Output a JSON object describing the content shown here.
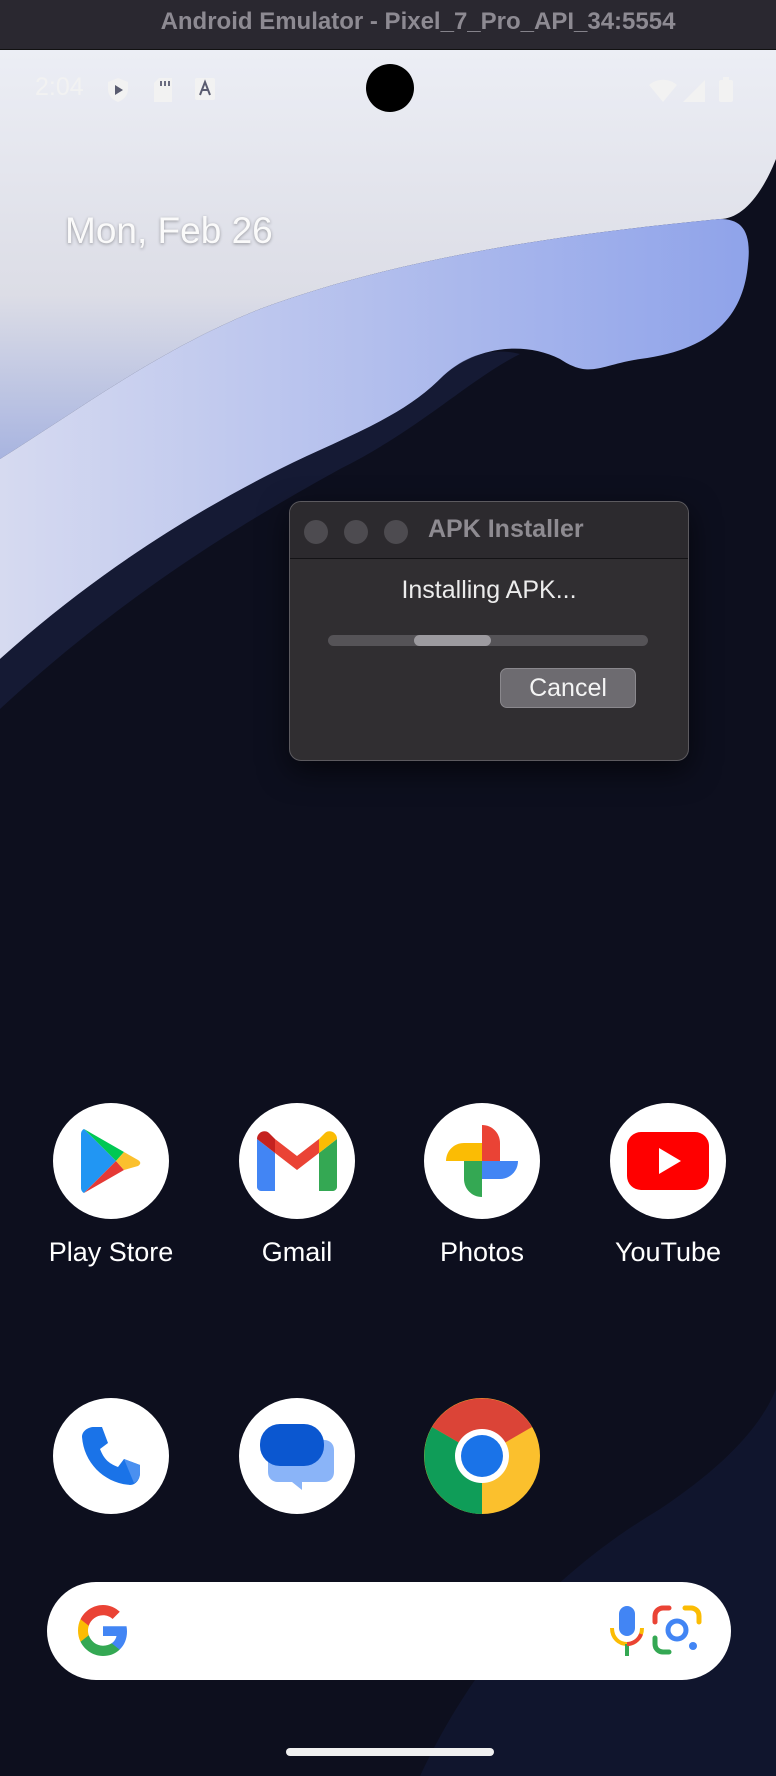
{
  "window": {
    "title": "Android Emulator - Pixel_7_Pro_API_34:5554"
  },
  "status_bar": {
    "time": "2:04",
    "left_icons": [
      "shield-play-icon",
      "sd-card-icon",
      "text-a-icon"
    ],
    "right_icons": [
      "wifi-icon",
      "signal-icon",
      "battery-icon"
    ]
  },
  "home": {
    "date": "Mon, Feb 26"
  },
  "dialog": {
    "title": "APK Installer",
    "message": "Installing APK...",
    "progress": {
      "indeterminate": true,
      "segment_start_fraction": 0.27,
      "segment_end_fraction": 0.51
    },
    "cancel_label": "Cancel"
  },
  "apps": [
    {
      "label": "Play Store",
      "icon": "play-store-icon"
    },
    {
      "label": "Gmail",
      "icon": "gmail-icon"
    },
    {
      "label": "Photos",
      "icon": "photos-icon"
    },
    {
      "label": "YouTube",
      "icon": "youtube-icon"
    }
  ],
  "dock": [
    {
      "icon": "phone-icon"
    },
    {
      "icon": "messages-icon"
    },
    {
      "icon": "chrome-icon"
    }
  ],
  "search_bar": {
    "icons": [
      "google-g-icon",
      "microphone-icon",
      "google-lens-icon"
    ]
  },
  "colors": {
    "title_bar": "#2a2830",
    "dialog": "#302e31",
    "wallpaper_dark": "#0d0f1e",
    "wallpaper_light": "#e6e8f2",
    "wallpaper_blue": "#9aaee8"
  }
}
